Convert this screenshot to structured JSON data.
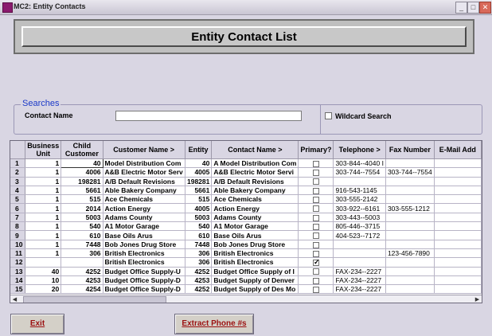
{
  "window": {
    "title": "MC2: Entity Contacts",
    "min": "_",
    "max": "□",
    "close": "✕"
  },
  "header": {
    "title": "Entity Contact List"
  },
  "searches": {
    "legend": "Searches",
    "contact_label": "Contact Name",
    "contact_value": "",
    "wildcard_label": "Wildcard Search",
    "wildcard_checked": false
  },
  "grid": {
    "columns": [
      "Business Unit",
      "Child Customer",
      "Customer Name >",
      "Entity",
      "Contact Name >",
      "Primary?",
      "Telephone >",
      "Fax Number",
      "E-Mail Add"
    ],
    "rows": [
      {
        "n": "1",
        "bu": "1",
        "child": "40",
        "customer": "Model Distribution Com",
        "entity": "40",
        "contact": "A Model Distribution Com",
        "primary": false,
        "tel": "303-844--4040 I",
        "fax": "",
        "email": ""
      },
      {
        "n": "2",
        "bu": "1",
        "child": "4006",
        "customer": "A&B Electric Motor Serv",
        "entity": "4005",
        "contact": "A&B Electric Motor Servi",
        "primary": false,
        "tel": "303-744--7554",
        "fax": "303-744--7554",
        "email": ""
      },
      {
        "n": "3",
        "bu": "1",
        "child": "198281",
        "customer": "A/B Default Revisions",
        "entity": "198281",
        "contact": "A/B Default Revisions",
        "primary": false,
        "tel": "",
        "fax": "",
        "email": ""
      },
      {
        "n": "4",
        "bu": "1",
        "child": "5661",
        "customer": "Able Bakery Company",
        "entity": "5661",
        "contact": "Able Bakery Company",
        "primary": false,
        "tel": "916-543-1145",
        "fax": "",
        "email": ""
      },
      {
        "n": "5",
        "bu": "1",
        "child": "515",
        "customer": "Ace Chemicals",
        "entity": "515",
        "contact": "Ace Chemicals",
        "primary": false,
        "tel": "303-555-2142",
        "fax": "",
        "email": ""
      },
      {
        "n": "6",
        "bu": "1",
        "child": "2014",
        "customer": "Action Energy",
        "entity": "4005",
        "contact": "Action Energy",
        "primary": false,
        "tel": "303-922--6161",
        "fax": "303-555-1212",
        "email": ""
      },
      {
        "n": "7",
        "bu": "1",
        "child": "5003",
        "customer": "Adams County",
        "entity": "5003",
        "contact": "Adams County",
        "primary": false,
        "tel": "303-443--5003",
        "fax": "",
        "email": ""
      },
      {
        "n": "8",
        "bu": "1",
        "child": "540",
        "customer": "A1 Motor Garage",
        "entity": "540",
        "contact": "A1 Motor Garage",
        "primary": false,
        "tel": "805-446--3715",
        "fax": "",
        "email": ""
      },
      {
        "n": "9",
        "bu": "1",
        "child": "610",
        "customer": "Base Oils Arus",
        "entity": "610",
        "contact": "Base Oils Arus",
        "primary": false,
        "tel": "404-523--7172",
        "fax": "",
        "email": ""
      },
      {
        "n": "10",
        "bu": "1",
        "child": "7448",
        "customer": "Bob Jones Drug Store",
        "entity": "7448",
        "contact": "Bob Jones Drug Store",
        "primary": false,
        "tel": "",
        "fax": "",
        "email": ""
      },
      {
        "n": "11",
        "bu": "1",
        "child": "306",
        "customer": "British Electronics",
        "entity": "306",
        "contact": "British Electronics",
        "primary": false,
        "tel": "",
        "fax": "123-456-7890",
        "email": ""
      },
      {
        "n": "12",
        "bu": "",
        "child": "",
        "customer": "British Electronics",
        "entity": "306",
        "contact": "British Electronics",
        "primary": true,
        "tel": "",
        "fax": "",
        "email": ""
      },
      {
        "n": "13",
        "bu": "40",
        "child": "4252",
        "customer": "Budget Office Supply-U",
        "entity": "4252",
        "contact": "Budget Office Supply of I",
        "primary": false,
        "tel": "FAX-234--2227",
        "fax": "",
        "email": ""
      },
      {
        "n": "14",
        "bu": "10",
        "child": "4253",
        "customer": "Budget Office Supply-D",
        "entity": "4253",
        "contact": "Budget Supply of Denver",
        "primary": false,
        "tel": "FAX-234--2227",
        "fax": "",
        "email": ""
      },
      {
        "n": "15",
        "bu": "20",
        "child": "4254",
        "customer": "Budget Office Supply-D",
        "entity": "4252",
        "contact": "Budget Supply of Des Mo",
        "primary": false,
        "tel": "FAX-234--2227",
        "fax": "",
        "email": ""
      }
    ]
  },
  "scroll": {
    "left": "◀",
    "right": "▶"
  },
  "buttons": {
    "exit": "Exit",
    "extract": "Extract Phone #s"
  }
}
